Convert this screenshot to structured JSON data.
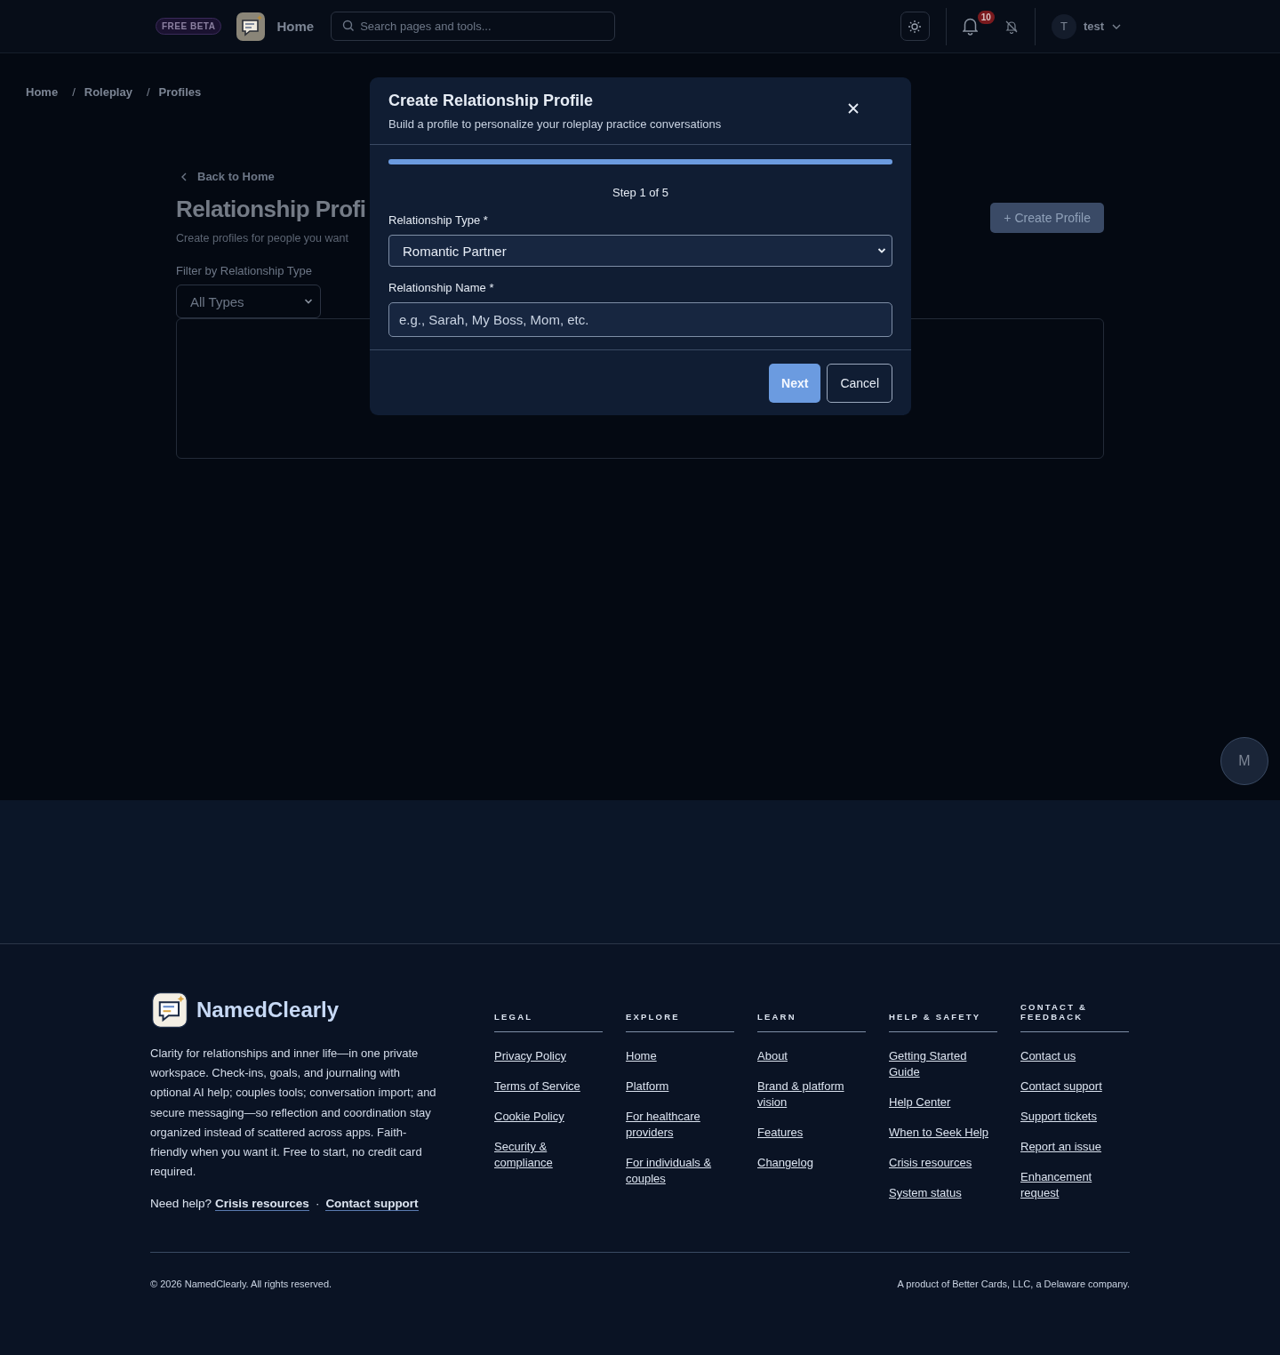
{
  "header": {
    "badge": "FREE BETA",
    "nav_title": "Home",
    "search": {
      "placeholder": "Search pages and tools..."
    },
    "notification_count": "10",
    "user": {
      "initial": "T",
      "name": "test"
    }
  },
  "breadcrumbs": [
    "Home",
    "Roleplay",
    "Profiles"
  ],
  "breadcrumb_separator": "/",
  "page": {
    "back_link": "Back to Home",
    "title": "Relationship Profi",
    "subtitle": "Create profiles for people you want",
    "create_button": "+ Create Profile",
    "filter": {
      "label": "Filter by Relationship Type",
      "value": "All Types"
    }
  },
  "modal": {
    "title": "Create Relationship Profile",
    "subtitle": "Build a profile to personalize your roleplay practice conversations",
    "progress": {
      "level": 1
    },
    "step": "Step 1 of 5",
    "fields": [
      {
        "kind": "select",
        "label": "Relationship Type *",
        "value": "Romantic Partner"
      },
      {
        "kind": "text",
        "label": "Relationship Name *",
        "placeholder": "e.g., Sarah, My Boss, Mom, etc."
      }
    ],
    "next_button": "Next",
    "cancel_button": "Cancel"
  },
  "floating_button": "M",
  "footer": {
    "brand": "NamedClearly",
    "description": "Clarity for relationships and inner life—in one private workspace. Check-ins, goals, and journaling with optional AI help; couples tools; conversation import; and secure messaging—so reflection and coordination stay organized instead of scattered across apps. Faith-friendly when you want it. Free to start, no credit card required.",
    "help": {
      "prefix": "Need help?",
      "links": [
        "Crisis resources",
        "Contact support"
      ],
      "separator": "·"
    },
    "columns": [
      {
        "heading": "LEGAL",
        "links": [
          "Privacy Policy",
          "Terms of Service",
          "Cookie Policy",
          "Security & compliance"
        ]
      },
      {
        "heading": "EXPLORE",
        "links": [
          "Home",
          "Platform",
          "For healthcare providers",
          "For individuals & couples"
        ]
      },
      {
        "heading": "LEARN",
        "links": [
          "About",
          "Brand & platform vision",
          "Features",
          "Changelog"
        ]
      },
      {
        "heading": "HELP & SAFETY",
        "links": [
          "Getting Started Guide",
          "Help Center",
          "When to Seek Help",
          "Crisis resources",
          "System status"
        ]
      },
      {
        "heading": "CONTACT & FEEDBACK",
        "links": [
          "Contact us",
          "Contact support",
          "Support tickets",
          "Report an issue",
          "Enhancement request"
        ]
      }
    ],
    "copyright": "© 2026 NamedClearly. All rights reserved.",
    "company": "A product of Better Cards, LLC, a Delaware company."
  }
}
